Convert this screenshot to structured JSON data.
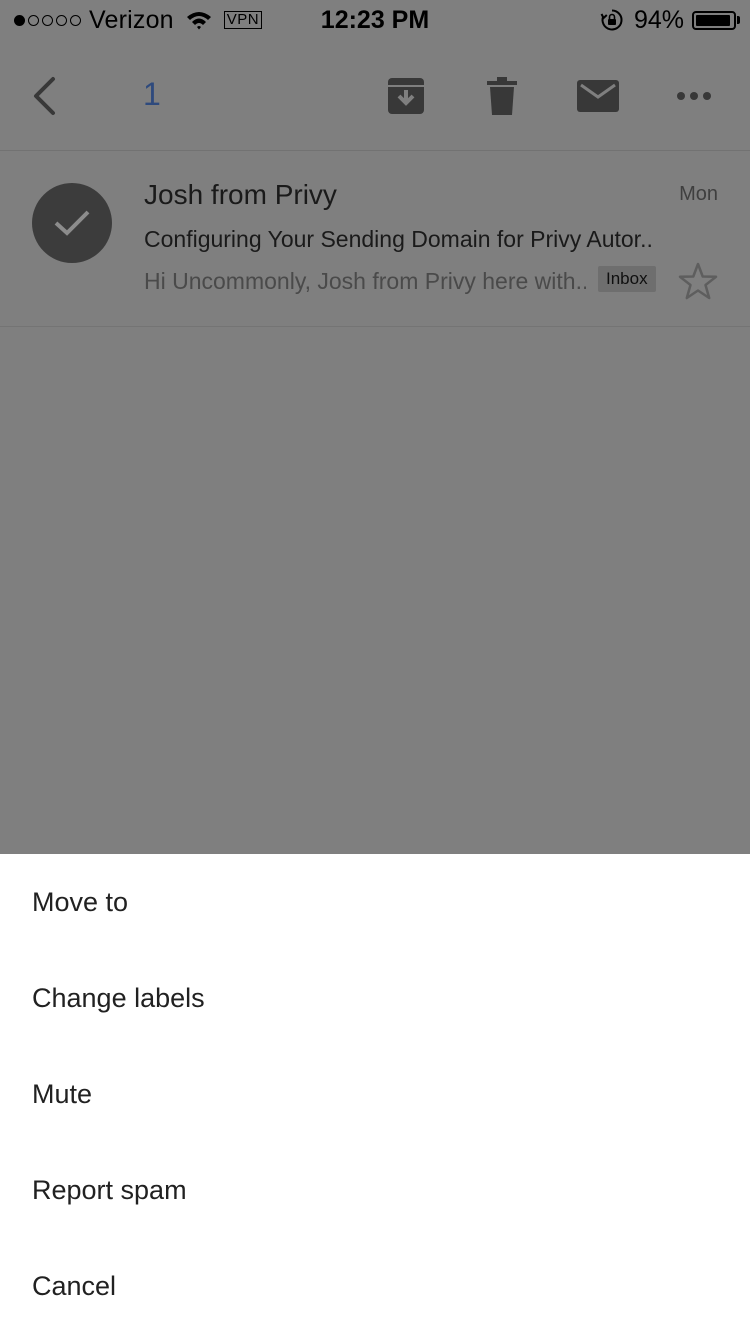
{
  "status_bar": {
    "carrier": "Verizon",
    "vpn": "VPN",
    "time": "12:23 PM",
    "battery_percent": "94%",
    "battery_level": 0.94,
    "signal_bars_filled": 1,
    "signal_bars_total": 5
  },
  "toolbar": {
    "selected_count": "1",
    "icons": [
      "back-icon",
      "archive-icon",
      "trash-icon",
      "mail-icon",
      "more-icon"
    ]
  },
  "email": {
    "sender": "Josh from Privy",
    "date": "Mon",
    "subject": "Configuring Your Sending Domain for Privy Autor...",
    "snippet": "Hi Uncommonly, Josh from Privy here with...",
    "label": "Inbox",
    "selected": true,
    "starred": false
  },
  "action_sheet": {
    "items": [
      {
        "label": "Move to"
      },
      {
        "label": "Change labels"
      },
      {
        "label": "Mute"
      },
      {
        "label": "Report spam"
      },
      {
        "label": "Cancel"
      }
    ]
  },
  "colors": {
    "overlay_background": "#7f7f7f",
    "count_accent": "#2e4a7d",
    "sheet_background": "#ffffff",
    "avatar": "#3c3c3c"
  }
}
